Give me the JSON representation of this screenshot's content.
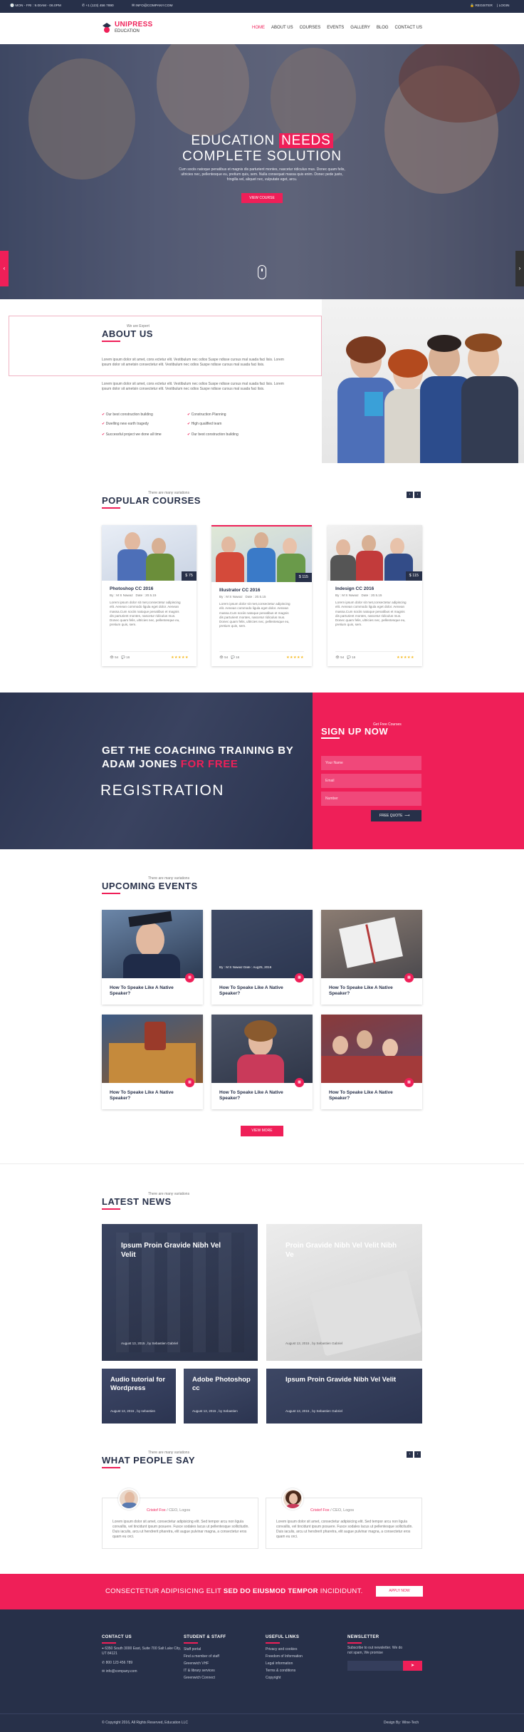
{
  "colors": {
    "accent": "#ef1f58",
    "navy": "#273049"
  },
  "topbar": {
    "hours": "MON - FRI : 9.00AM - 06.0PM",
    "phone": "+1 (123) 456 7890",
    "email": "INFO@COMPANY.COM",
    "register": "REGISTER",
    "login": "LOGIN"
  },
  "header": {
    "logo": "UNIPRESS",
    "logo_sub": "EDUCATION",
    "nav": [
      "HOME",
      "ABOUT US",
      "COURSES",
      "EVENTS",
      "GALLERY",
      "BLOG",
      "CONTACT US"
    ]
  },
  "hero": {
    "title_a": "EDUCATION",
    "title_b": "NEEDS",
    "title_c": "COMPLETE SOLUTION",
    "text": "Cum sociis natoque penatibus et magnis dis parturient montes, nascetur ridiculus mus. Donec quam felis, ultricies nec, pellentesque eu, pretium quis, sem. Nulla consequat massa quis enim. Donec pede justo, fringilla vel, aliquet nec, vulputate eget, arcu.",
    "button": "VIEW COURSE"
  },
  "about": {
    "eyebrow": "We are Expert",
    "title": "ABOUT US",
    "para1": "Lorem ipsum dolor sit amet, cons ectetur elit. Vestibulum nec odios Suspe ndisse cursus mal suada faci lisis. Lorem ipsum dolor sit ametsin consectetur elit. Vestibulum nec odios Suspe ndisse cursus mal suada faci lisis.",
    "para2": "Lorem ipsum dolor sit amet, cons ectetur elit. Vestibulum nec odios Suspe ndisse cursus mal suada faci lisis. Lorem ipsum dolor sit ametsin consectetur elit. Vestibulum nec odios Suspe ndisse cursus mal suada faci lisis.",
    "checks": [
      "Our best construction building",
      "Construction Planning",
      "Dwelling new earth tragedy",
      "High qualified team",
      "Successful project we done all time",
      "Our best construction building"
    ]
  },
  "courses": {
    "eyebrow": "There are many variations",
    "title": "POPULAR COURSES",
    "items": [
      {
        "price": "$ 75",
        "title": "Photoshop CC 2016",
        "by": "By : M S Nawaz",
        "date": "Date : 20.5.15",
        "desc": "Lorem ipsum dolor sit met,consectetur adipiscing elit. Aenean commodo ligula eget dolor. Aenean massa.Cum sociis natoque penatibus et magnis dis parturient montes, nascetur ridiculus mus. Donec quam felis, ultricies nec, pellentesque eu, pretium quis, sem.",
        "views": "54",
        "comments": "16",
        "stars": "★★★★★"
      },
      {
        "price": "$ 115",
        "title": "Illustrator CC 2016",
        "by": "By : M S Nawaz",
        "date": "Date : 20.5.15",
        "desc": "Lorem ipsum dolor sit met,consectetur adipiscing elit. Aenean commodo ligula eget dolor. Aenean massa.Cum sociis natoque penatibus et magnis dis parturient montes, nascetur ridiculus mus. Donec quam felis, ultricies nec, pellentesque eu, pretium quis, sem.",
        "views": "54",
        "comments": "16",
        "stars": "★★★★★"
      },
      {
        "price": "$ 115",
        "title": "Indesign CC 2016",
        "by": "By : M S Nawaz",
        "date": "Date : 20.5.15",
        "desc": "Lorem ipsum dolor sit met,consectetur adipiscing elit. Aenean commodo ligula eget dolor. Aenean massa.Cum sociis natoque penatibus et magnis dis parturient montes, nascetur ridiculus mus. Donec quam felis, ultricies nec, pellentesque eu, pretium quis, sem.",
        "views": "54",
        "comments": "16",
        "stars": "★★★★★"
      }
    ]
  },
  "coaching": {
    "line1": "GET THE COACHING TRAINING BY",
    "line2": "ADAM JONES",
    "line2_accent": "FOR FREE",
    "registration": "REGISTRATION",
    "signup_eyebrow": "Get Free Courses",
    "signup_title": "SIGN UP NOW",
    "name_ph": "Your Name",
    "email_ph": "Email",
    "number_ph": "Number",
    "button": "FREE QUOTE"
  },
  "events": {
    "eyebrow": "There are many variations",
    "title": "UPCOMING EVENTS",
    "hover_meta": "By : M S Nawaz   Date : Aug25, 2016",
    "items": [
      {
        "title": "How To Speake Like A Native Speaker?"
      },
      {
        "title": "How To Speake Like A Native Speaker?"
      },
      {
        "title": "How To Speake Like A Native Speaker?"
      },
      {
        "title": "How To Speake Like A Native Speaker?"
      },
      {
        "title": "How To Speake Like A Native Speaker?"
      },
      {
        "title": "How To Speake Like A Native Speaker?"
      }
    ],
    "button": "VIEW MORE"
  },
  "news": {
    "eyebrow": "There are many variations",
    "title": "LATEST NEWS",
    "items": [
      {
        "title": "Ipsum Proin Gravide Nibh Vel Velit",
        "date": "August 13, 2015 , by Sebastien Gabriel"
      },
      {
        "title": "Proin Gravide Nibh Vel Velit Nibh Ve",
        "date": "August 13, 2015 , by Sebastien Gabriel"
      },
      {
        "title": "Audio tutorial for Wordpress",
        "date": "August 13, 2015 , by sebastien"
      },
      {
        "title": "Adobe Photoshop cc",
        "date": "August 13, 2015 , by Sebastien"
      },
      {
        "title": "Ipsum Proin Gravide Nibh Vel Velit",
        "date": "August 13, 2015 , by Sebastien Gabriel"
      }
    ]
  },
  "testimonials": {
    "eyebrow": "There are many variations",
    "title": "WHAT PEOPLE SAY",
    "items": [
      {
        "name": "Cristof Fox",
        "role": "/ CEO, Logos",
        "quote": "Lorem ipsum dolor sit amet, consectetur adipisicing elit. Sed tempor arcu non ligula convallis, vel tincidunt ipsum posuere. Fusce sodales lacus ut pellentesque sollicitudin. Duis iaculis, arcu ut hendrerit pharetra, elit augue pulvinar magna, a consectetur eros quam eu orci."
      },
      {
        "name": "Cristof Fox",
        "role": "/ CEO, Logos",
        "quote": "Lorem ipsum dolor sit amet, consectetur adipisicing elit. Sed tempor arcu non ligula convallis, vel tincidunt ipsum posuere. Fusce sodales lacus ut pellentesque sollicitudin. Duis iaculis, arcu ut hendrerit pharetra, elit augue pulvinar magna, a consectetur eros quam eu orci."
      }
    ]
  },
  "cta": {
    "text_a": "CONSECTETUR ADIPISICING ELIT",
    "text_b": "SED DO EIUSMOD TEMPOR",
    "text_c": "INCIDIDUNT.",
    "button": "APPLY NOW"
  },
  "footer": {
    "contact_title": "CONTACT US",
    "address": "6350 South 3000 East, Suite 700 Salt Lake City, UT 84121",
    "phone": "800 123 456 789",
    "email": "info@company.com",
    "staff_title": "STUDENT & STAFF",
    "staff_links": [
      "Staff portal",
      "Find a member of staff",
      "Greenwich VHF",
      "IT & library services",
      "Greenwich Connect"
    ],
    "useful_title": "USEFUL LINKS",
    "useful_links": [
      "Privacy and cookies",
      "Freedom of Information",
      "Legal information",
      "Terms & conditions",
      "Copyright"
    ],
    "newsletter_title": "NEWSLETTER",
    "newsletter_text": "Subscribe to out newsletter. We do not spam, We promise",
    "copyright": "© Copyright 2016, All Rights Reserved, Education LLC",
    "credit": "Design By: Wine-Tech"
  }
}
